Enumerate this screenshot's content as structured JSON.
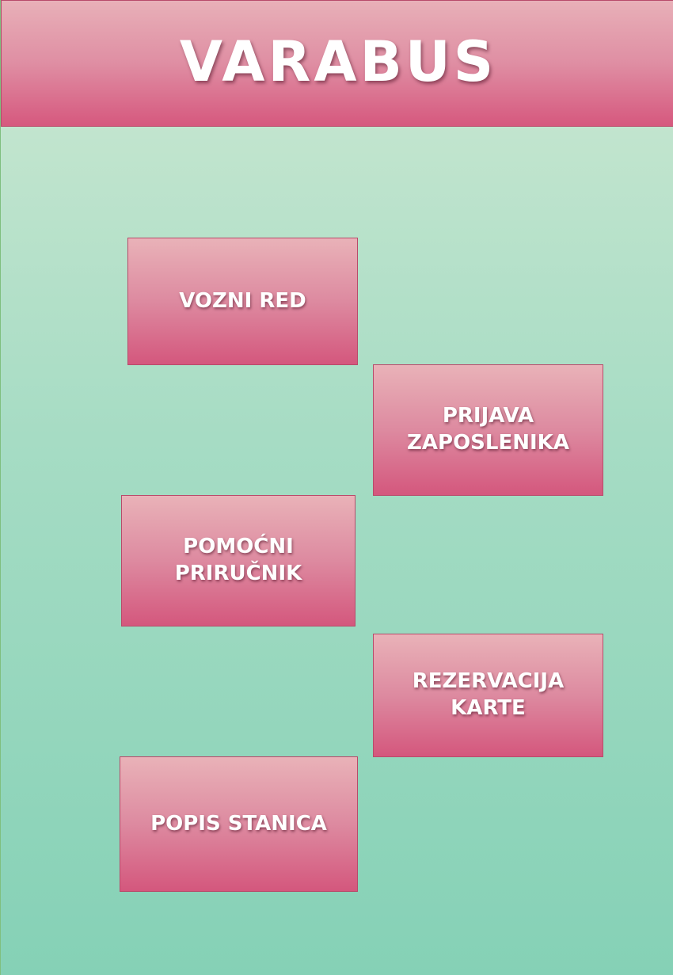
{
  "header": {
    "title": "VARABUS"
  },
  "menu": {
    "items": [
      {
        "label": "VOZNI RED"
      },
      {
        "label": "PRIJAVA\nZAPOSLENIKA"
      },
      {
        "label": "POMOĆNI\nPRIRUČNIK"
      },
      {
        "label": "REZERVACIJA\nKARTE"
      },
      {
        "label": "POPIS STANICA"
      }
    ]
  },
  "colors": {
    "header_top": "#e8b0b8",
    "header_bottom": "#d6587e",
    "background_top": "#cde8d2",
    "background_bottom": "#85d1b6",
    "text": "#ffffff"
  }
}
